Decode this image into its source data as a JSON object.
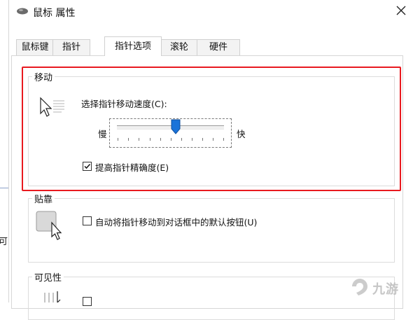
{
  "window": {
    "title": "鼠标 属性"
  },
  "tabs": [
    {
      "label": "鼠标键",
      "active": false
    },
    {
      "label": "指针",
      "active": false
    },
    {
      "label": "指针选项",
      "active": true
    },
    {
      "label": "滚轮",
      "active": false
    },
    {
      "label": "硬件",
      "active": false
    }
  ],
  "motion": {
    "group_title": "移动",
    "speed_label": "选择指针移动速度(C):",
    "slow_label": "慢",
    "fast_label": "快",
    "speed_level": 0.55,
    "precision_label": "提高指针精确度(E)",
    "precision_checked": true
  },
  "snap": {
    "group_title": "贴靠",
    "checkbox_label": "自动将指针移动到对话框中的默认按钮(U)",
    "checked": false
  },
  "visibility": {
    "group_title": "可见性"
  },
  "background": {
    "left_char": "可"
  },
  "colors": {
    "highlight": "#e8191f",
    "thumb": "#1a73d9",
    "watermark": "#bdbdbd"
  },
  "watermark": {
    "text": "九游"
  }
}
